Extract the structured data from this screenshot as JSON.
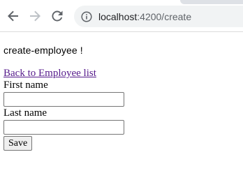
{
  "browser": {
    "url_host": "localhost",
    "url_path": ":4200/create",
    "icons": {
      "back": "arrow-left-icon",
      "forward": "arrow-right-icon",
      "reload": "reload-icon",
      "site_info": "info-icon"
    },
    "colors": {
      "omnibox_bg": "#f1f3f4",
      "icon_active": "#5f6368",
      "icon_disabled": "#bdc1c6"
    }
  },
  "page": {
    "heading": "create-employee !",
    "back_link": "Back to Employee list",
    "form": {
      "first_name_label": "First name",
      "first_name_value": "",
      "last_name_label": "Last name",
      "last_name_value": "",
      "save_label": "Save"
    },
    "colors": {
      "link_visited": "#551a8b"
    }
  }
}
